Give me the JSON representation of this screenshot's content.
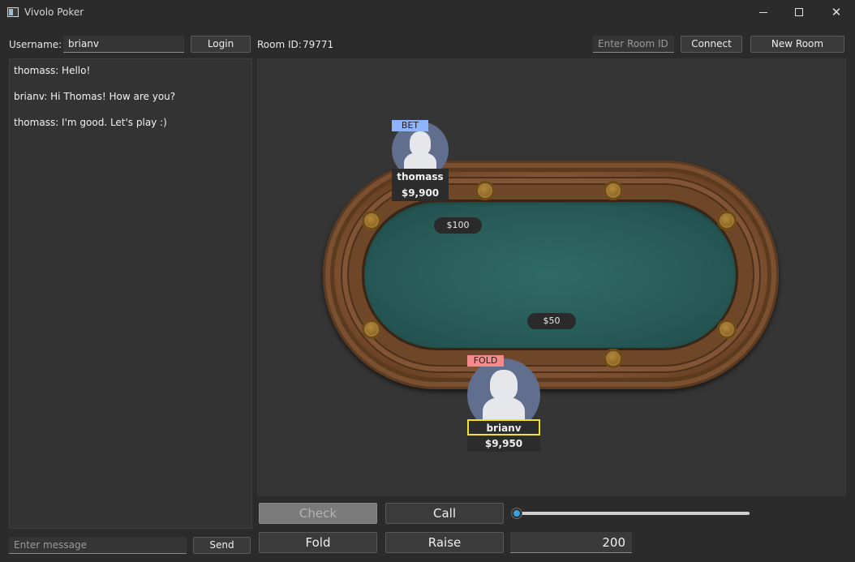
{
  "window": {
    "title": "Vivolo Poker",
    "controls": {
      "minimize_icon": "minimize-icon",
      "maximize_icon": "maximize-icon",
      "close_icon": "close-icon",
      "close_glyph": "✕"
    }
  },
  "header": {
    "username_label": "Username:",
    "username_value": "brianv",
    "login_label": "Login",
    "room_id_label": "Room ID:",
    "room_id_value": "79771",
    "room_input_placeholder": "Enter Room ID",
    "connect_label": "Connect",
    "new_room_label": "New Room"
  },
  "chat": {
    "messages": [
      "thomass: Hello!",
      "brianv: Hi Thomas! How are you?",
      "thomass: I'm good. Let's play :)"
    ],
    "input_placeholder": "Enter message",
    "send_label": "Send"
  },
  "table": {
    "bets": [
      "$100",
      "$50"
    ],
    "players": [
      {
        "name": "thomass",
        "stack": "$9,900",
        "action": "BET",
        "action_color": "#8fb4ff"
      },
      {
        "name": "brianv",
        "stack": "$9,950",
        "action": "FOLD",
        "action_color": "#f28b8b",
        "highlight_color": "#f2e22a"
      }
    ]
  },
  "actions": {
    "check_label": "Check",
    "call_label": "Call",
    "fold_label": "Fold",
    "raise_label": "Raise",
    "raise_amount": "200",
    "slider_level": 0,
    "accent_color": "#3aa0e0"
  }
}
